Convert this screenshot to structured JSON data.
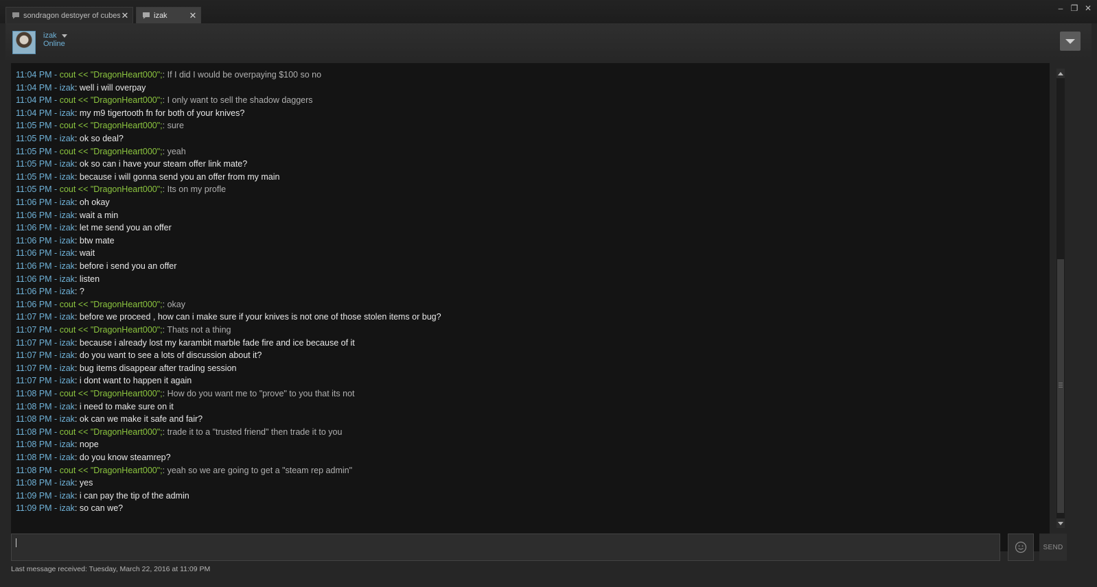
{
  "tabs": [
    {
      "label": "sondragon destoyer of cubes",
      "active": false,
      "close": "✕"
    },
    {
      "label": "izak",
      "active": true,
      "close": "✕"
    }
  ],
  "window_controls": {
    "minimize": "–",
    "maximize": "❐",
    "close": "✕"
  },
  "friend": {
    "name": "izak",
    "status": "Online"
  },
  "messages": [
    {
      "time": "11:04 PM",
      "sender": "cout << \"DragonHeart000\";",
      "mine": false,
      "text": "If I did I would be overpaying $100 so no"
    },
    {
      "time": "11:04 PM",
      "sender": "izak",
      "mine": true,
      "text": "well i will overpay"
    },
    {
      "time": "11:04 PM",
      "sender": "cout << \"DragonHeart000\";",
      "mine": false,
      "text": "I only want to sell the shadow daggers"
    },
    {
      "time": "11:04 PM",
      "sender": "izak",
      "mine": true,
      "text": "my m9 tigertooth fn for both of your knives?"
    },
    {
      "time": "11:05 PM",
      "sender": "cout << \"DragonHeart000\";",
      "mine": false,
      "text": "sure"
    },
    {
      "time": "11:05 PM",
      "sender": "izak",
      "mine": true,
      "text": "ok so deal?"
    },
    {
      "time": "11:05 PM",
      "sender": "cout << \"DragonHeart000\";",
      "mine": false,
      "text": "yeah"
    },
    {
      "time": "11:05 PM",
      "sender": "izak",
      "mine": true,
      "text": "ok so can i have your steam offer link mate?"
    },
    {
      "time": "11:05 PM",
      "sender": "izak",
      "mine": true,
      "text": "because i will gonna send you an offer from my main"
    },
    {
      "time": "11:05 PM",
      "sender": "cout << \"DragonHeart000\";",
      "mine": false,
      "text": "Its on my profle"
    },
    {
      "time": "11:06 PM",
      "sender": "izak",
      "mine": true,
      "text": "oh okay"
    },
    {
      "time": "11:06 PM",
      "sender": "izak",
      "mine": true,
      "text": "wait a min"
    },
    {
      "time": "11:06 PM",
      "sender": "izak",
      "mine": true,
      "text": "let me send you an offer"
    },
    {
      "time": "11:06 PM",
      "sender": "izak",
      "mine": true,
      "text": "btw mate"
    },
    {
      "time": "11:06 PM",
      "sender": "izak",
      "mine": true,
      "text": "wait"
    },
    {
      "time": "11:06 PM",
      "sender": "izak",
      "mine": true,
      "text": "before i send you an offer"
    },
    {
      "time": "11:06 PM",
      "sender": "izak",
      "mine": true,
      "text": "listen"
    },
    {
      "time": "11:06 PM",
      "sender": "izak",
      "mine": true,
      "text": "?"
    },
    {
      "time": "11:06 PM",
      "sender": "cout << \"DragonHeart000\";",
      "mine": false,
      "text": "okay"
    },
    {
      "time": "11:07 PM",
      "sender": "izak",
      "mine": true,
      "text": "before we proceed , how can i make sure if your knives is not one of those stolen items or bug?"
    },
    {
      "time": "11:07 PM",
      "sender": "cout << \"DragonHeart000\";",
      "mine": false,
      "text": "Thats not a thing"
    },
    {
      "time": "11:07 PM",
      "sender": "izak",
      "mine": true,
      "text": "because i already lost my karambit marble fade fire and ice because of it"
    },
    {
      "time": "11:07 PM",
      "sender": "izak",
      "mine": true,
      "text": "do you want to see a lots of discussion about it?"
    },
    {
      "time": "11:07 PM",
      "sender": "izak",
      "mine": true,
      "text": "bug items disappear after trading session"
    },
    {
      "time": "11:07 PM",
      "sender": "izak",
      "mine": true,
      "text": "i dont want to happen it again"
    },
    {
      "time": "11:08 PM",
      "sender": "cout << \"DragonHeart000\";",
      "mine": false,
      "text": "How do you want me to \"prove\" to you that its not"
    },
    {
      "time": "11:08 PM",
      "sender": "izak",
      "mine": true,
      "text": "i need to make sure on it"
    },
    {
      "time": "11:08 PM",
      "sender": "izak",
      "mine": true,
      "text": "ok can we make it safe and fair?"
    },
    {
      "time": "11:08 PM",
      "sender": "cout << \"DragonHeart000\";",
      "mine": false,
      "text": "trade it to a \"trusted friend\" then trade it to you"
    },
    {
      "time": "11:08 PM",
      "sender": "izak",
      "mine": true,
      "text": "nope"
    },
    {
      "time": "11:08 PM",
      "sender": "izak",
      "mine": true,
      "text": "do you know steamrep?"
    },
    {
      "time": "11:08 PM",
      "sender": "cout << \"DragonHeart000\";",
      "mine": false,
      "text": "yeah so we are going to get a \"steam rep admin\""
    },
    {
      "time": "11:08 PM",
      "sender": "izak",
      "mine": true,
      "text": "yes"
    },
    {
      "time": "11:09 PM",
      "sender": "izak",
      "mine": true,
      "text": "i can pay the tip of the admin"
    },
    {
      "time": "11:09 PM",
      "sender": "izak",
      "mine": true,
      "text": "so can we?"
    }
  ],
  "composer": {
    "value": "",
    "placeholder": ""
  },
  "send_label": "SEND",
  "status_line": "Last message received: Tuesday, March 22, 2016 at 11:09 PM",
  "colors": {
    "timestamp": "#6fb2d8",
    "other_sender": "#8cc63f",
    "my_text": "#e8e8e8",
    "other_text": "#b0b0b0",
    "log_background": "#141414"
  },
  "icons": {
    "tab": "chat-bubble-icon",
    "emoticon": "smiley-icon",
    "options": "chevron-down-icon"
  }
}
